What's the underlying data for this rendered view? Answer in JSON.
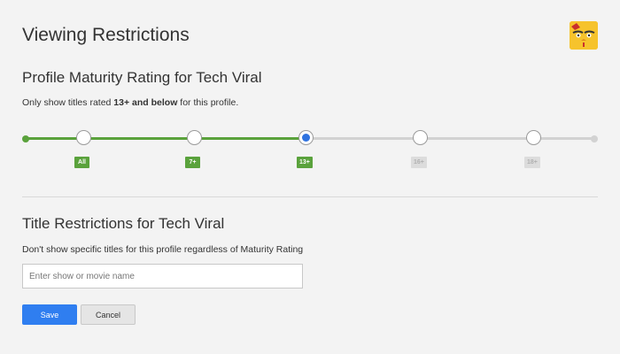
{
  "page": {
    "title": "Viewing Restrictions"
  },
  "maturity": {
    "heading": "Profile Maturity Rating for Tech Viral",
    "desc_prefix": "Only show titles rated ",
    "desc_bold": "13+ and below",
    "desc_suffix": " for this profile.",
    "levels": [
      {
        "label": "All",
        "active": true
      },
      {
        "label": "7+",
        "active": true
      },
      {
        "label": "13+",
        "active": true,
        "selected": true
      },
      {
        "label": "16+",
        "active": false
      },
      {
        "label": "18+",
        "active": false
      }
    ],
    "selected_index": 2
  },
  "title_restrictions": {
    "heading": "Title Restrictions for Tech Viral",
    "description": "Don't show specific titles for this profile regardless of Maturity Rating",
    "search_value": "",
    "search_placeholder": "Enter show or movie name"
  },
  "actions": {
    "save_label": "Save",
    "cancel_label": "Cancel"
  },
  "colors": {
    "active_green": "#5aa23c",
    "selected_blue": "#2f73e0",
    "save_blue": "#2f7ef0"
  }
}
